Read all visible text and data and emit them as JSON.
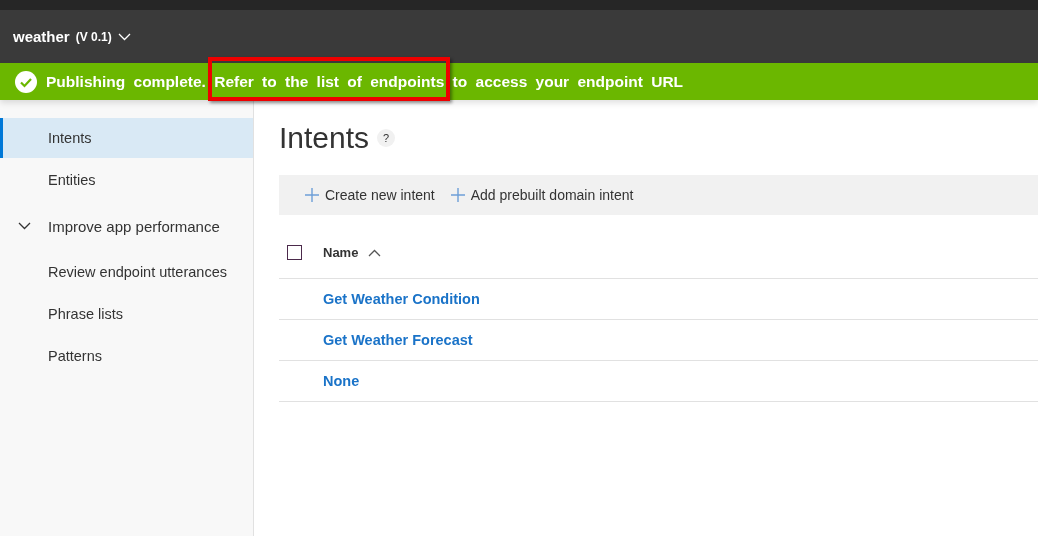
{
  "header": {
    "app_name": "weather",
    "version": "(V 0.1)"
  },
  "banner": {
    "message": "Publishing complete. Refer to the list of endpoints to access your endpoint URL",
    "highlighted": true
  },
  "sidebar": {
    "items": [
      {
        "kind": "link",
        "label": "Intents",
        "selected": true
      },
      {
        "kind": "link",
        "label": "Entities",
        "selected": false
      },
      {
        "kind": "group",
        "label": "Improve app performance",
        "selected": false,
        "expanded": true,
        "children": [
          {
            "kind": "link",
            "label": "Review endpoint utterances",
            "selected": false
          },
          {
            "kind": "link",
            "label": "Phrase lists",
            "selected": false
          },
          {
            "kind": "link",
            "label": "Patterns",
            "selected": false
          }
        ]
      }
    ]
  },
  "page": {
    "title": "Intents",
    "help": "?"
  },
  "toolbar": {
    "buttons": [
      "Create new intent",
      "Add prebuilt domain intent"
    ]
  },
  "table": {
    "select_all_checked": false,
    "column": {
      "label": "Name",
      "sort_ascending": true
    },
    "rows": [
      {
        "name": "Get Weather Condition"
      },
      {
        "name": "Get Weather Forecast"
      },
      {
        "name": "None"
      }
    ]
  }
}
